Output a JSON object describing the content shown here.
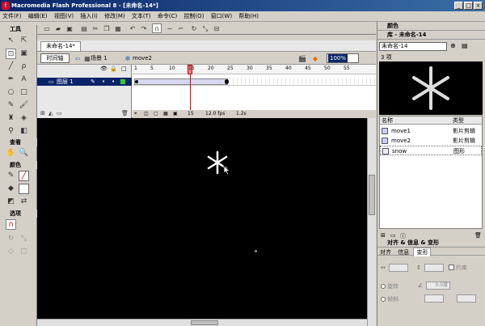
{
  "window": {
    "title": "Macromedia Flash Professional 8 - [未命名-14*]",
    "app_logo": "f",
    "controls": [
      "_",
      "□",
      "×"
    ]
  },
  "menu": [
    "文件(F)",
    "编辑(E)",
    "视图(V)",
    "插入(I)",
    "修改(M)",
    "文本(T)",
    "命令(C)",
    "控制(O)",
    "窗口(W)",
    "帮助(H)"
  ],
  "tools_panel": {
    "title": "工具",
    "view_label": "查看",
    "colors_label": "颜色",
    "options_label": "选项"
  },
  "document": {
    "tab": "未命名-14*",
    "timeline_button": "时间轴",
    "scene": "场景 1",
    "symbol": "move2",
    "zoom": "100%"
  },
  "timeline": {
    "layer_name": "图层 1",
    "ruler": [
      "1",
      "5",
      "10",
      "15",
      "20",
      "25",
      "30",
      "35",
      "40",
      "45",
      "50",
      "55"
    ],
    "current_frame": "15",
    "fps": "12.0 fps",
    "time": "1.2s"
  },
  "right_panel": {
    "color_header": "颜色",
    "library_header": "库 - 未命名-14",
    "library_doc": "未命名-14",
    "item_count": "3 项",
    "col_name": "名称",
    "col_type": "类型",
    "items": [
      {
        "name": "move1",
        "type": "影片剪辑"
      },
      {
        "name": "move2",
        "type": "影片剪辑"
      },
      {
        "name": "snow",
        "type": "图形"
      }
    ],
    "align_header": "对齐 & 信息 & 变形",
    "align_tabs": [
      "对齐",
      "信息",
      "变形"
    ],
    "constrain_label": "约束",
    "rotate_label": "旋转",
    "skew_label": "倾斜",
    "rotate_value": "0.0度"
  }
}
